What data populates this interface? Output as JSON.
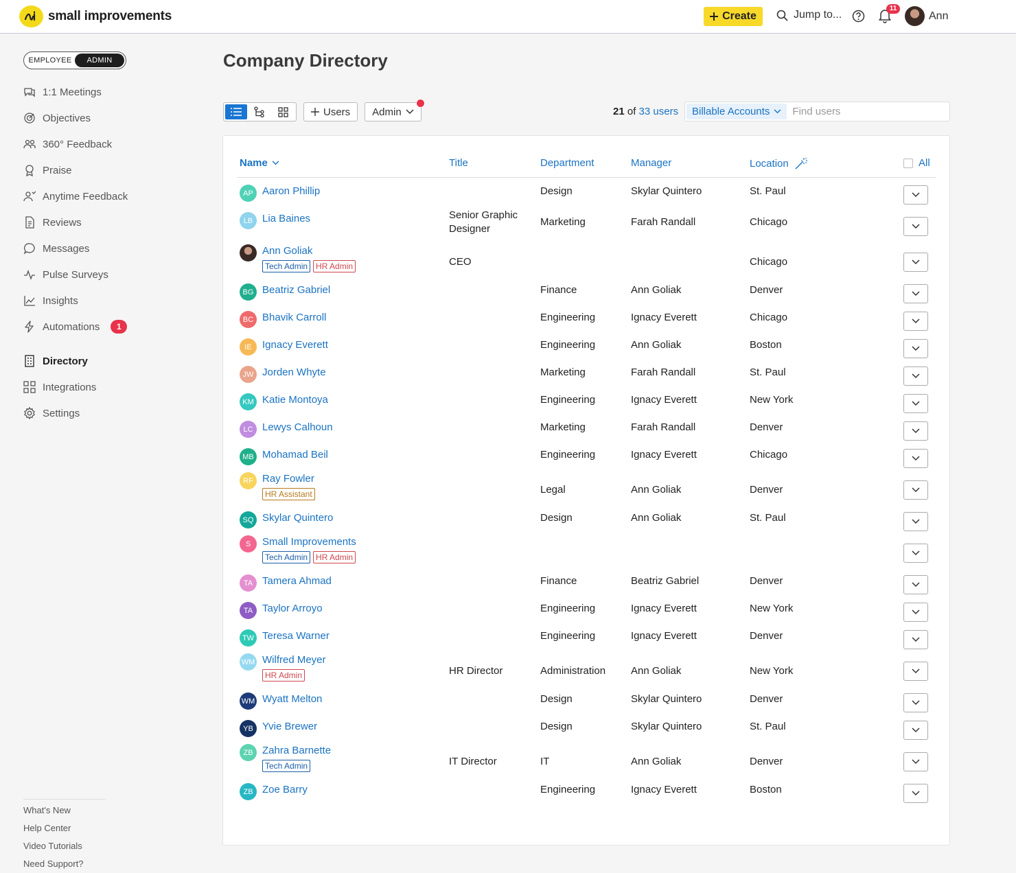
{
  "app": {
    "name": "small improvements"
  },
  "header": {
    "create_label": "Create",
    "jump_label": "Jump to...",
    "notifications_count": "11",
    "user_name": "Ann"
  },
  "sidebar": {
    "mode": {
      "employee": "EMPLOYEE",
      "admin": "ADMIN"
    },
    "items": [
      {
        "label": "1:1 Meetings",
        "icon": "meetings-icon"
      },
      {
        "label": "Objectives",
        "icon": "objectives-icon"
      },
      {
        "label": "360° Feedback",
        "icon": "feedback-360-icon"
      },
      {
        "label": "Praise",
        "icon": "praise-icon"
      },
      {
        "label": "Anytime Feedback",
        "icon": "anytime-feedback-icon"
      },
      {
        "label": "Reviews",
        "icon": "reviews-icon"
      },
      {
        "label": "Messages",
        "icon": "messages-icon"
      },
      {
        "label": "Pulse Surveys",
        "icon": "pulse-icon"
      },
      {
        "label": "Insights",
        "icon": "insights-icon"
      },
      {
        "label": "Automations",
        "icon": "automations-icon",
        "badge": "1"
      }
    ],
    "admin_items": [
      {
        "label": "Directory",
        "icon": "directory-icon"
      },
      {
        "label": "Integrations",
        "icon": "integrations-icon"
      },
      {
        "label": "Settings",
        "icon": "settings-icon"
      }
    ],
    "footer": [
      "What's New",
      "Help Center",
      "Video Tutorials",
      "Need Support?"
    ]
  },
  "main": {
    "title": "Company Directory",
    "toolbar": {
      "users_label": "Users",
      "role_label": "Admin"
    },
    "count": {
      "shown": "21",
      "of": "of",
      "total": "33 users"
    },
    "filter": {
      "tag": "Billable Accounts",
      "placeholder": "Find users"
    },
    "columns": {
      "name": "Name",
      "title": "Title",
      "department": "Department",
      "manager": "Manager",
      "location": "Location",
      "all": "All"
    },
    "rows": [
      {
        "initials": "AP",
        "color": "#4fd1b6",
        "name": "Aaron Phillip",
        "title": "",
        "department": "Design",
        "manager": "Skylar Quintero",
        "location": "St. Paul",
        "badges": []
      },
      {
        "initials": "LB",
        "color": "#8fd3ec",
        "name": "Lia Baines",
        "title": "Senior Graphic Designer",
        "department": "Marketing",
        "manager": "Farah Randall",
        "location": "Chicago",
        "badges": []
      },
      {
        "initials": "",
        "color": "#3a2a26",
        "photo": true,
        "name": "Ann Goliak",
        "title": "CEO",
        "department": "",
        "manager": "",
        "location": "Chicago",
        "badges": [
          {
            "type": "tech",
            "label": "Tech Admin"
          },
          {
            "type": "hr",
            "label": "HR Admin"
          }
        ]
      },
      {
        "initials": "BG",
        "color": "#1fae8e",
        "name": "Beatriz Gabriel",
        "title": "",
        "department": "Finance",
        "manager": "Ann Goliak",
        "location": "Denver",
        "badges": []
      },
      {
        "initials": "BC",
        "color": "#ef6b6b",
        "name": "Bhavik Carroll",
        "title": "",
        "department": "Engineering",
        "manager": "Ignacy Everett",
        "location": "Chicago",
        "badges": []
      },
      {
        "initials": "IE",
        "color": "#f7b955",
        "name": "Ignacy Everett",
        "title": "",
        "department": "Engineering",
        "manager": "Ann Goliak",
        "location": "Boston",
        "badges": []
      },
      {
        "initials": "JW",
        "color": "#e9a48b",
        "name": "Jorden Whyte",
        "title": "",
        "department": "Marketing",
        "manager": "Farah Randall",
        "location": "St. Paul",
        "badges": []
      },
      {
        "initials": "KM",
        "color": "#35c8c0",
        "name": "Katie Montoya",
        "title": "",
        "department": "Engineering",
        "manager": "Ignacy Everett",
        "location": "New York",
        "badges": []
      },
      {
        "initials": "LC",
        "color": "#c08de0",
        "name": "Lewys Calhoun",
        "title": "",
        "department": "Marketing",
        "manager": "Farah Randall",
        "location": "Denver",
        "badges": []
      },
      {
        "initials": "MB",
        "color": "#1fb08a",
        "name": "Mohamad Beil",
        "title": "",
        "department": "Engineering",
        "manager": "Ignacy Everett",
        "location": "Chicago",
        "badges": []
      },
      {
        "initials": "RF",
        "color": "#f8d45c",
        "name": "Ray Fowler",
        "title": "",
        "department": "Legal",
        "manager": "Ann Goliak",
        "location": "Denver",
        "badges": [
          {
            "type": "asst",
            "label": "HR Assistant"
          }
        ]
      },
      {
        "initials": "SQ",
        "color": "#13a79a",
        "name": "Skylar Quintero",
        "title": "",
        "department": "Design",
        "manager": "Ann Goliak",
        "location": "St. Paul",
        "badges": []
      },
      {
        "initials": "S",
        "color": "#f2668f",
        "name": "Small Improvements",
        "title": "",
        "department": "",
        "manager": "",
        "location": "",
        "badges": [
          {
            "type": "tech",
            "label": "Tech Admin"
          },
          {
            "type": "hr",
            "label": "HR Admin"
          }
        ]
      },
      {
        "initials": "TA",
        "color": "#e48fd0",
        "name": "Tamera Ahmad",
        "title": "",
        "department": "Finance",
        "manager": "Beatriz Gabriel",
        "location": "Denver",
        "badges": []
      },
      {
        "initials": "TA",
        "color": "#8e5cc4",
        "name": "Taylor Arroyo",
        "title": "",
        "department": "Engineering",
        "manager": "Ignacy Everett",
        "location": "New York",
        "badges": []
      },
      {
        "initials": "TW",
        "color": "#2fcab6",
        "name": "Teresa Warner",
        "title": "",
        "department": "Engineering",
        "manager": "Ignacy Everett",
        "location": "Denver",
        "badges": []
      },
      {
        "initials": "WM",
        "color": "#95d9f0",
        "name": "Wilfred Meyer",
        "title": "HR Director",
        "department": "Administration",
        "manager": "Ann Goliak",
        "location": "New York",
        "badges": [
          {
            "type": "hr",
            "label": "HR Admin"
          }
        ]
      },
      {
        "initials": "WM",
        "color": "#1d3b78",
        "name": "Wyatt Melton",
        "title": "",
        "department": "Design",
        "manager": "Skylar Quintero",
        "location": "Denver",
        "badges": []
      },
      {
        "initials": "YB",
        "color": "#153364",
        "name": "Yvie Brewer",
        "title": "",
        "department": "Design",
        "manager": "Skylar Quintero",
        "location": "St. Paul",
        "badges": []
      },
      {
        "initials": "ZB",
        "color": "#5dd3b0",
        "name": "Zahra Barnette",
        "title": "IT Director",
        "department": "IT",
        "manager": "Ann Goliak",
        "location": "Denver",
        "badges": [
          {
            "type": "tech",
            "label": "Tech Admin"
          }
        ]
      },
      {
        "initials": "ZB",
        "color": "#27b7c4",
        "name": "Zoe Barry",
        "title": "",
        "department": "Engineering",
        "manager": "Ignacy Everett",
        "location": "Boston",
        "badges": []
      }
    ]
  }
}
